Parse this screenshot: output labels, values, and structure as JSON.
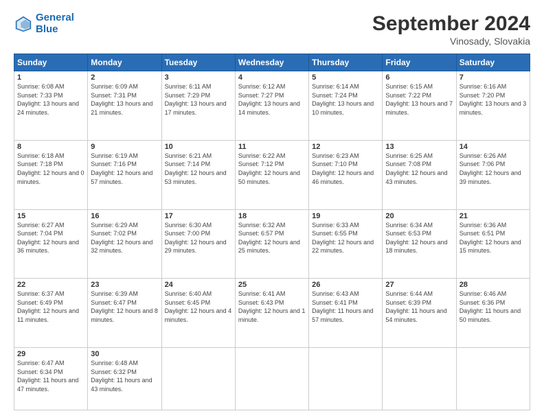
{
  "header": {
    "logo_line1": "General",
    "logo_line2": "Blue",
    "title": "September 2024",
    "subtitle": "Vinosady, Slovakia"
  },
  "weekdays": [
    "Sunday",
    "Monday",
    "Tuesday",
    "Wednesday",
    "Thursday",
    "Friday",
    "Saturday"
  ],
  "weeks": [
    [
      {
        "day": "1",
        "sunrise": "6:08 AM",
        "sunset": "7:33 PM",
        "daylight": "13 hours and 24 minutes."
      },
      {
        "day": "2",
        "sunrise": "6:09 AM",
        "sunset": "7:31 PM",
        "daylight": "13 hours and 21 minutes."
      },
      {
        "day": "3",
        "sunrise": "6:11 AM",
        "sunset": "7:29 PM",
        "daylight": "13 hours and 17 minutes."
      },
      {
        "day": "4",
        "sunrise": "6:12 AM",
        "sunset": "7:27 PM",
        "daylight": "13 hours and 14 minutes."
      },
      {
        "day": "5",
        "sunrise": "6:14 AM",
        "sunset": "7:24 PM",
        "daylight": "13 hours and 10 minutes."
      },
      {
        "day": "6",
        "sunrise": "6:15 AM",
        "sunset": "7:22 PM",
        "daylight": "13 hours and 7 minutes."
      },
      {
        "day": "7",
        "sunrise": "6:16 AM",
        "sunset": "7:20 PM",
        "daylight": "13 hours and 3 minutes."
      }
    ],
    [
      {
        "day": "8",
        "sunrise": "6:18 AM",
        "sunset": "7:18 PM",
        "daylight": "12 hours and 0 minutes."
      },
      {
        "day": "9",
        "sunrise": "6:19 AM",
        "sunset": "7:16 PM",
        "daylight": "12 hours and 57 minutes."
      },
      {
        "day": "10",
        "sunrise": "6:21 AM",
        "sunset": "7:14 PM",
        "daylight": "12 hours and 53 minutes."
      },
      {
        "day": "11",
        "sunrise": "6:22 AM",
        "sunset": "7:12 PM",
        "daylight": "12 hours and 50 minutes."
      },
      {
        "day": "12",
        "sunrise": "6:23 AM",
        "sunset": "7:10 PM",
        "daylight": "12 hours and 46 minutes."
      },
      {
        "day": "13",
        "sunrise": "6:25 AM",
        "sunset": "7:08 PM",
        "daylight": "12 hours and 43 minutes."
      },
      {
        "day": "14",
        "sunrise": "6:26 AM",
        "sunset": "7:06 PM",
        "daylight": "12 hours and 39 minutes."
      }
    ],
    [
      {
        "day": "15",
        "sunrise": "6:27 AM",
        "sunset": "7:04 PM",
        "daylight": "12 hours and 36 minutes."
      },
      {
        "day": "16",
        "sunrise": "6:29 AM",
        "sunset": "7:02 PM",
        "daylight": "12 hours and 32 minutes."
      },
      {
        "day": "17",
        "sunrise": "6:30 AM",
        "sunset": "7:00 PM",
        "daylight": "12 hours and 29 minutes."
      },
      {
        "day": "18",
        "sunrise": "6:32 AM",
        "sunset": "6:57 PM",
        "daylight": "12 hours and 25 minutes."
      },
      {
        "day": "19",
        "sunrise": "6:33 AM",
        "sunset": "6:55 PM",
        "daylight": "12 hours and 22 minutes."
      },
      {
        "day": "20",
        "sunrise": "6:34 AM",
        "sunset": "6:53 PM",
        "daylight": "12 hours and 18 minutes."
      },
      {
        "day": "21",
        "sunrise": "6:36 AM",
        "sunset": "6:51 PM",
        "daylight": "12 hours and 15 minutes."
      }
    ],
    [
      {
        "day": "22",
        "sunrise": "6:37 AM",
        "sunset": "6:49 PM",
        "daylight": "12 hours and 11 minutes."
      },
      {
        "day": "23",
        "sunrise": "6:39 AM",
        "sunset": "6:47 PM",
        "daylight": "12 hours and 8 minutes."
      },
      {
        "day": "24",
        "sunrise": "6:40 AM",
        "sunset": "6:45 PM",
        "daylight": "12 hours and 4 minutes."
      },
      {
        "day": "25",
        "sunrise": "6:41 AM",
        "sunset": "6:43 PM",
        "daylight": "12 hours and 1 minute."
      },
      {
        "day": "26",
        "sunrise": "6:43 AM",
        "sunset": "6:41 PM",
        "daylight": "11 hours and 57 minutes."
      },
      {
        "day": "27",
        "sunrise": "6:44 AM",
        "sunset": "6:39 PM",
        "daylight": "11 hours and 54 minutes."
      },
      {
        "day": "28",
        "sunrise": "6:46 AM",
        "sunset": "6:36 PM",
        "daylight": "11 hours and 50 minutes."
      }
    ],
    [
      {
        "day": "29",
        "sunrise": "6:47 AM",
        "sunset": "6:34 PM",
        "daylight": "11 hours and 47 minutes."
      },
      {
        "day": "30",
        "sunrise": "6:48 AM",
        "sunset": "6:32 PM",
        "daylight": "11 hours and 43 minutes."
      },
      null,
      null,
      null,
      null,
      null
    ]
  ]
}
